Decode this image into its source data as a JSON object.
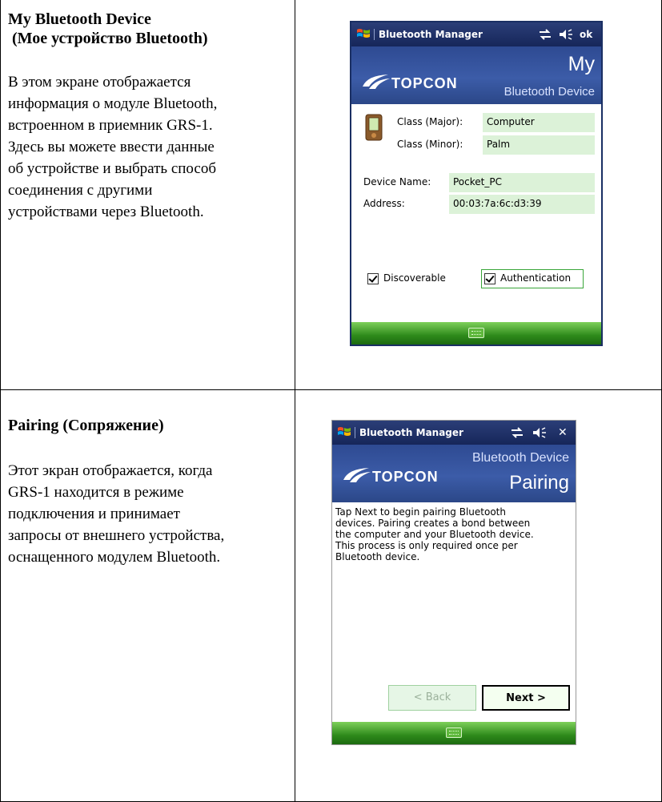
{
  "row1": {
    "title_line1": "My Bluetooth Device",
    "title_line2": " (Мое устройство Bluetooth)",
    "text_lines": [
      "В этом экране отображается",
      "информация о модуле Bluetooth,",
      "встроенном в приемник GRS-1.",
      "Здесь вы можете ввести данные",
      "об устройстве и выбрать способ",
      "соединения с другими",
      "устройствами через Bluetooth."
    ],
    "device": {
      "app_title": "Bluetooth Manager",
      "ok_label": "ok",
      "brand": "TOPCON",
      "header_big": "My",
      "header_small": "Bluetooth Device",
      "class_major_label": "Class (Major):",
      "class_major_value": "Computer",
      "class_minor_label": "Class (Minor):",
      "class_minor_value": "Palm",
      "device_name_label": "Device Name:",
      "device_name_value": "Pocket_PC",
      "address_label": "Address:",
      "address_value": "00:03:7a:6c:d3:39",
      "discoverable_label": "Discoverable",
      "authentication_label": "Authentication",
      "discoverable_checked": true,
      "authentication_checked": true
    }
  },
  "row2": {
    "title": "Pairing (Сопряжение)",
    "text_lines": [
      "Этот экран отображается, когда",
      "GRS-1 находится в режиме",
      "подключения и принимает",
      "запросы от внешнего устройства,",
      "оснащенного модулем Bluetooth."
    ],
    "device": {
      "app_title": "Bluetooth Manager",
      "close_label": "✕",
      "brand": "TOPCON",
      "header_small": "Bluetooth Device",
      "header_big": "Pairing",
      "instruction_lines": [
        "Tap Next to begin pairing Bluetooth",
        "devices. Pairing creates a bond between",
        "the computer and your Bluetooth device.",
        "This process is only required once per",
        "Bluetooth device."
      ],
      "back_label": "< Back",
      "next_label": "Next >"
    }
  },
  "colors": {
    "status_bar": "#1e2f66",
    "header": "#3554a0",
    "value_field": "#dcf2d8",
    "bottom_bar": "#2e8a1b"
  }
}
